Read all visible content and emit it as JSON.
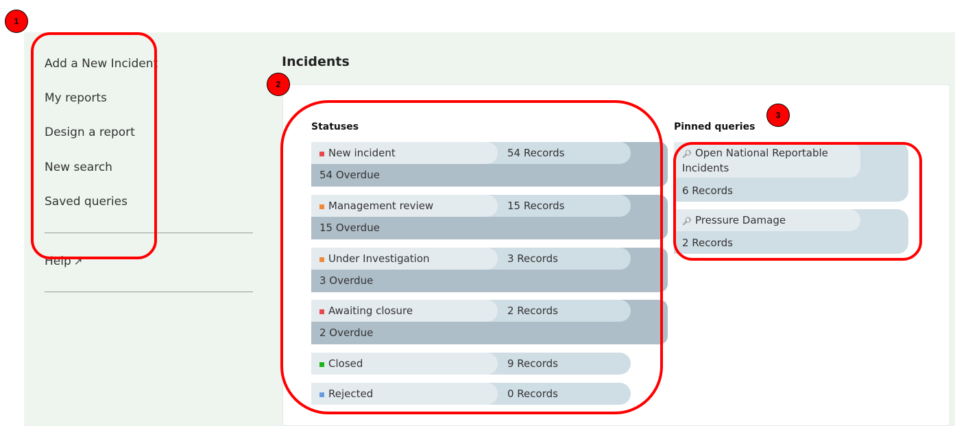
{
  "sidebar": {
    "items": [
      {
        "label": "Add a New Incident"
      },
      {
        "label": "My reports"
      },
      {
        "label": "Design a report"
      },
      {
        "label": "New search"
      },
      {
        "label": "Saved queries"
      }
    ],
    "help": {
      "label": "Help",
      "icon": "external-link-icon"
    }
  },
  "main": {
    "title": "Incidents",
    "statuses": {
      "title": "Statuses",
      "items": [
        {
          "name": "New incident",
          "records": "54 Records",
          "overdue": "54 Overdue",
          "color": "#e8474b"
        },
        {
          "name": "Management review",
          "records": "15 Records",
          "overdue": "15 Overdue",
          "color": "#f0883a"
        },
        {
          "name": "Under Investigation",
          "records": "3 Records",
          "overdue": "3 Overdue",
          "color": "#f0883a"
        },
        {
          "name": "Awaiting closure",
          "records": "2 Records",
          "overdue": "2 Overdue",
          "color": "#e8474b"
        },
        {
          "name": "Closed",
          "records": "9 Records",
          "overdue": null,
          "color": "#19b519"
        },
        {
          "name": "Rejected",
          "records": "0 Records",
          "overdue": null,
          "color": "#6a9be0"
        }
      ]
    },
    "pinned_queries": {
      "title": "Pinned queries",
      "items": [
        {
          "name": "Open National Reportable Incidents",
          "records": "6 Records",
          "icon": "search-icon"
        },
        {
          "name": "Pressure Damage",
          "records": "2 Records",
          "icon": "search-icon"
        }
      ]
    }
  },
  "annotations": [
    {
      "label": "1"
    },
    {
      "label": "2"
    },
    {
      "label": "3"
    }
  ],
  "colors": {
    "app_background": "#eef5ef",
    "annotation": "#ff0000",
    "card_dark": "#aebec8",
    "card_mid": "#cfdde5",
    "card_light": "#e4ebef"
  }
}
